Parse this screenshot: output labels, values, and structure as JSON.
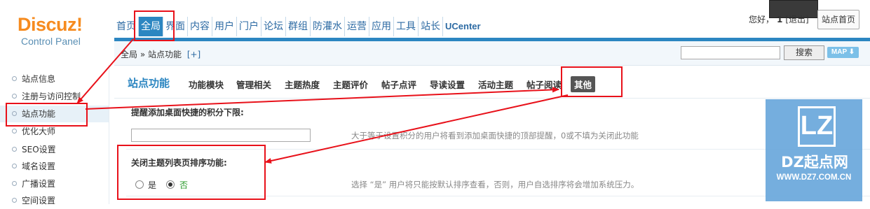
{
  "header": {
    "logo_word": "Discuz!",
    "logo_sub": "Control Panel",
    "nav": [
      "首页",
      "全局",
      "界面",
      "内容",
      "用户",
      "门户",
      "论坛",
      "群组",
      "防灌水",
      "运营",
      "应用",
      "工具",
      "站长",
      "UCenter"
    ],
    "active_nav": "全局",
    "greeting": "您好，",
    "user": "1",
    "logout": "[退出]",
    "site_home": "站点首页"
  },
  "breadcrumb": {
    "path": "全局 » 站点功能",
    "add": "[+]"
  },
  "search": {
    "button": "搜索",
    "map": "MAP ⬇"
  },
  "sidebar": {
    "items": [
      {
        "label": "站点信息"
      },
      {
        "label": "注册与访问控制"
      },
      {
        "label": "站点功能"
      },
      {
        "label": "优化大师"
      },
      {
        "label": "SEO设置"
      },
      {
        "label": "域名设置"
      },
      {
        "label": "广播设置"
      },
      {
        "label": "空间设置"
      }
    ],
    "active": "站点功能"
  },
  "main": {
    "section_title": "站点功能",
    "tabs": [
      "功能模块",
      "管理相关",
      "主题热度",
      "主题评价",
      "帖子点评",
      "导读设置",
      "活动主题",
      "帖子阅读",
      "其他"
    ],
    "active_tab": "其他",
    "settings": [
      {
        "label": "提醒添加桌面快捷的积分下限:",
        "value": "",
        "tip": "大于等于设置积分的用户将看到添加桌面快捷的顶部提醒，0或不填为关闭此功能"
      },
      {
        "label": "关闭主题列表页排序功能:",
        "options": [
          "是",
          "否"
        ],
        "selected": "否",
        "tip": "选择 “是” 用户将只能按默认排序查看，否则，用户自选排序将会增加系统压力。"
      }
    ]
  },
  "watermark": {
    "logo_text": "LZ",
    "name": "DZ起点网",
    "url": "WWW.DZ7.COM.CN"
  },
  "colors": {
    "accent": "#2c86c1",
    "highlight": "#e8111a",
    "logo_orange": "#f68b1f"
  }
}
